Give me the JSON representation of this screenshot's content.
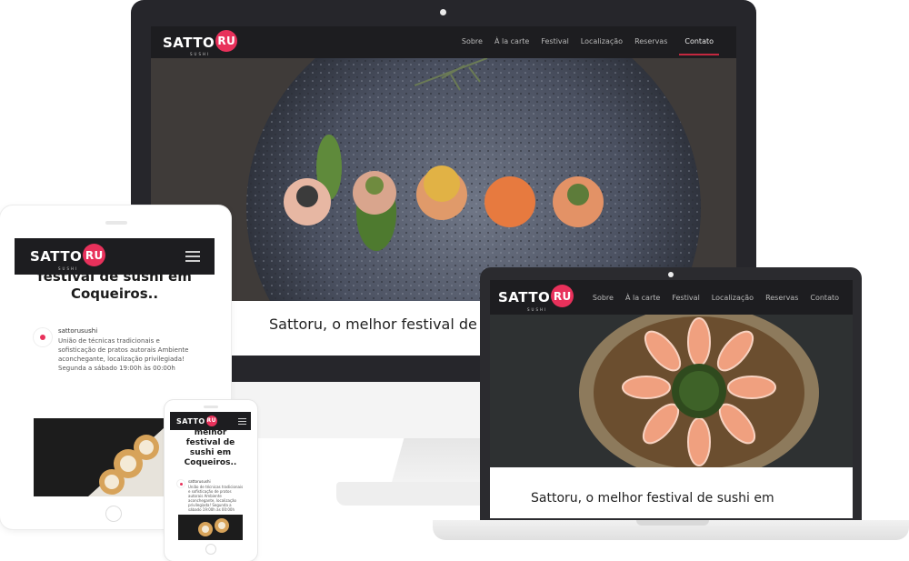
{
  "brand": {
    "logo_main": "SATTO",
    "logo_badge": "RU",
    "logo_sub": "SUSHI",
    "accent_color": "#e8315b"
  },
  "nav": {
    "items": [
      "Sobre",
      "À la carte",
      "Festival",
      "Localização",
      "Reservas",
      "Contato"
    ],
    "active": "Contato"
  },
  "desktop": {
    "headline": "Sattoru, o melhor festival de s"
  },
  "laptop": {
    "headline": "Sattoru, o melhor festival de sushi em"
  },
  "tablet": {
    "title": "Sattoru, o melhor festival de sushi em Coqueiros..",
    "post_author": "sattorusushi",
    "post_text": "União de técnicas tradicionais e sofisticação de pratos autorais Ambiente aconchegante, localização privilegiada! Segunda a sábado 19:00h às 00:00h"
  },
  "phone": {
    "title": "Sattoru, o melhor festival de sushi em Coqueiros..",
    "post_author": "sattorusushi",
    "post_text": "União de técnicas tradicionais e sofisticação de pratos autorais Ambiente aconchegante, localização privilegiada! Segunda a sábado 19:00h às 00:00h"
  },
  "icons": {
    "menu": "hamburger-menu-icon",
    "camera": "camera-dot",
    "home": "home-button"
  }
}
